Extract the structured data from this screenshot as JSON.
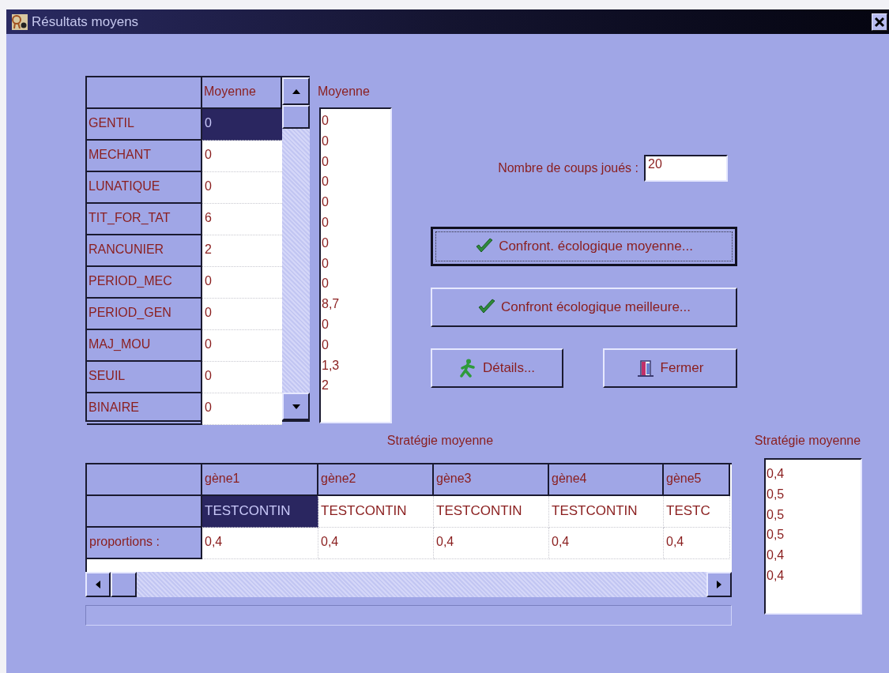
{
  "window": {
    "title": "Résultats moyens"
  },
  "scores_table": {
    "column": "Moyenne",
    "rows": [
      {
        "label": "GENTIL",
        "value": "0",
        "selected": true
      },
      {
        "label": "MECHANT",
        "value": "0",
        "selected": false
      },
      {
        "label": "LUNATIQUE",
        "value": "0",
        "selected": false
      },
      {
        "label": "TIT_FOR_TAT",
        "value": "6",
        "selected": false
      },
      {
        "label": "RANCUNIER",
        "value": "2",
        "selected": false
      },
      {
        "label": "PERIOD_MEC",
        "value": "0",
        "selected": false
      },
      {
        "label": "PERIOD_GEN",
        "value": "0",
        "selected": false
      },
      {
        "label": "MAJ_MOU",
        "value": "0",
        "selected": false
      },
      {
        "label": "SEUIL",
        "value": "0",
        "selected": false
      },
      {
        "label": "BINAIRE",
        "value": "0",
        "selected": false
      }
    ]
  },
  "scores_list": {
    "label": "Moyenne",
    "items": [
      "0",
      "0",
      "0",
      "0",
      "0",
      "0",
      "0",
      "0",
      "0",
      "8,7",
      "0",
      "0",
      "1,3",
      "2"
    ]
  },
  "coups": {
    "label": "Nombre de coups joués :",
    "value": "20"
  },
  "buttons": [
    {
      "label": "Confront. écologique moyenne...",
      "kind": "check",
      "default": true
    },
    {
      "label": "Confront écologique meilleure...",
      "kind": "check",
      "default": false
    },
    {
      "label": "Détails...",
      "kind": "walker",
      "default": false
    },
    {
      "label": "Fermer",
      "kind": "door",
      "default": false
    }
  ],
  "strategy_table": {
    "label": "Stratégie moyenne",
    "columns": [
      "gène1",
      "gène2",
      "gène3",
      "gène4",
      "gène5"
    ],
    "rows": [
      {
        "cells": [
          {
            "text": "TESTCONTIN",
            "selected": true
          },
          {
            "text": "TESTCONTIN",
            "selected": false
          },
          {
            "text": "TESTCONTIN",
            "selected": false
          },
          {
            "text": "TESTCONTIN",
            "selected": false
          },
          {
            "text": "TESTC",
            "selected": false
          }
        ]
      },
      {
        "label": "proportions :",
        "cells": [
          {
            "text": "0,4",
            "selected": false
          },
          {
            "text": "0,4",
            "selected": false
          },
          {
            "text": "0,4",
            "selected": false
          },
          {
            "text": "0,4",
            "selected": false
          },
          {
            "text": "0,4",
            "selected": false
          }
        ]
      }
    ]
  },
  "strategy_list": {
    "label": "Stratégie moyenne",
    "items": [
      "0,4",
      "0,5",
      "0,5",
      "0,5",
      "0,4",
      "0,4"
    ]
  }
}
